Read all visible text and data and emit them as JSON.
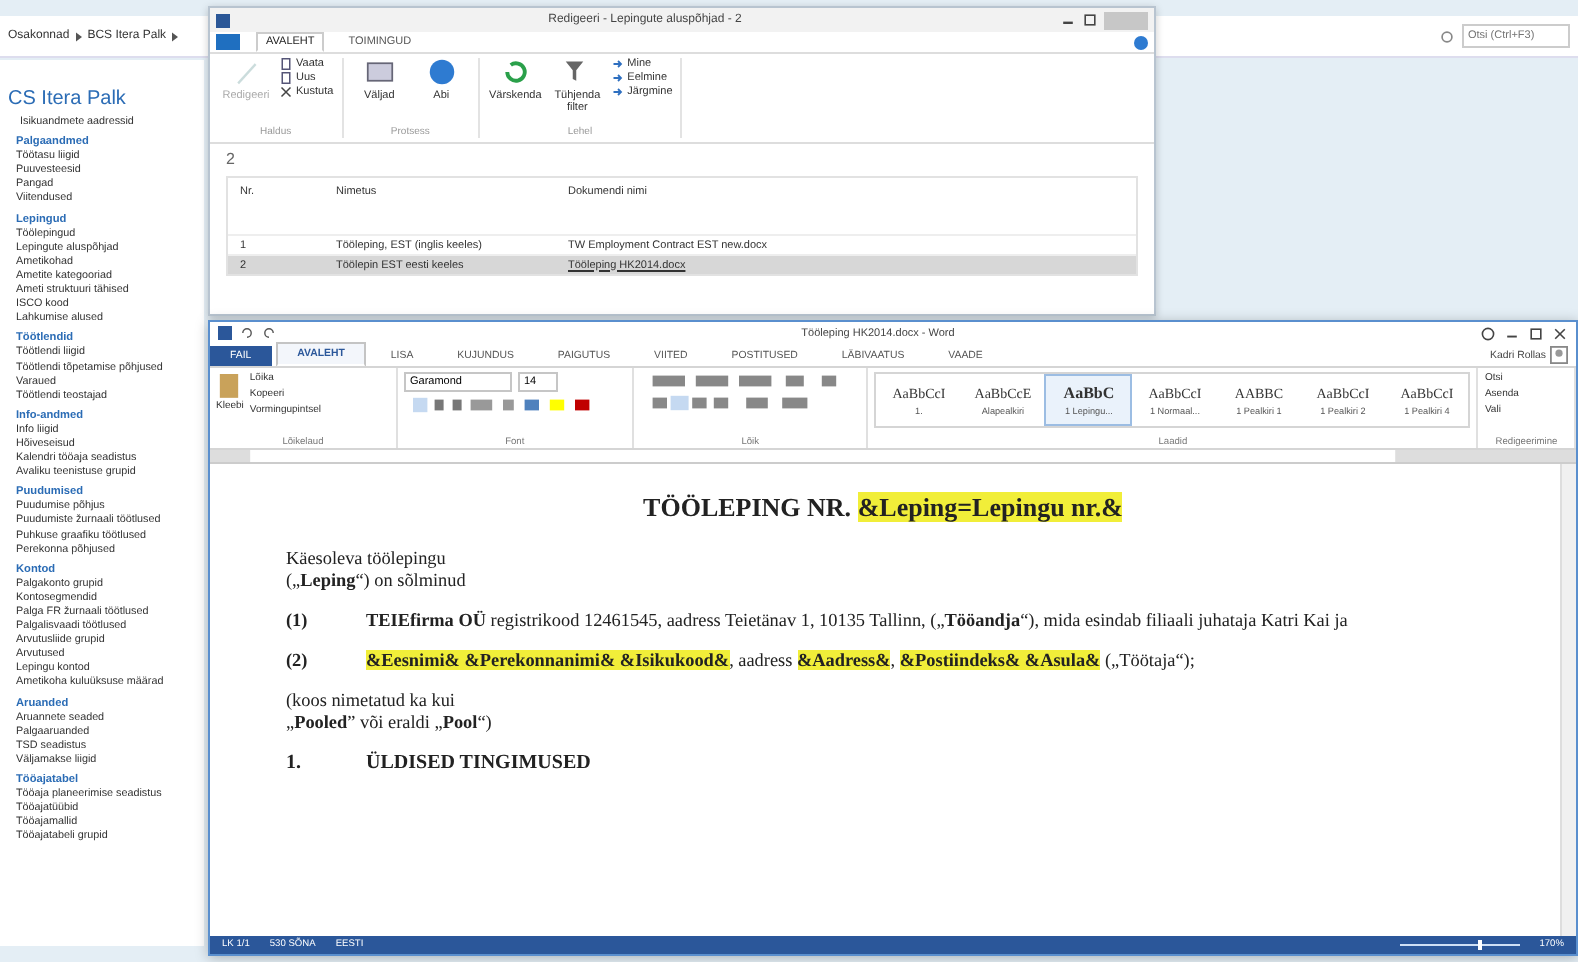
{
  "nav": {
    "breadcrumb": [
      "Osakonnad",
      "BCS Itera Palk"
    ],
    "search": {
      "placeholder": "Otsi (Ctrl+F3)"
    }
  },
  "sidebar": {
    "title": "CS Itera Palk",
    "top_item": "Isikuandmete aadressid",
    "groups": [
      {
        "title": "Palgaandmed",
        "items": [
          "Töötasu liigid",
          "Puuvesteesid",
          "Pangad",
          "Viitendused"
        ]
      },
      {
        "title": "Lepingud",
        "items": [
          "Töölepingud",
          "Lepingute aluspõhjad",
          "Ametikohad",
          "Ametite kategooriad",
          "Ameti struktuuri tähised",
          "ISCO kood",
          "Lahkumise alused"
        ]
      },
      {
        "title": "Töötlendid",
        "items": [
          "Töötlendi liigid",
          "Töötlendi tõpetamise põhjused",
          "Varaued",
          "Töötlendi teostajad"
        ]
      },
      {
        "title": "Info-andmed",
        "items": [
          "Info liigid",
          "Hõiveseisud",
          "Kalendri tööaja seadistus",
          "Avaliku teenistuse grupid"
        ]
      },
      {
        "title": "Puudumised",
        "items": [
          "Puudumise põhjus",
          "Puudumiste žurnaali töötlused",
          "Puhkuse graafiku töötlused",
          "Perekonna põhjused"
        ]
      },
      {
        "title": "Kontod",
        "items": [
          "Palgakonto grupid",
          "Kontosegmendid",
          "Palga FR žurnaali töötlused",
          "Palgalisvaadi töötlused",
          "Arvutusliide grupid",
          "Arvutused",
          "Lepingu kontod",
          "Ametikoha kuluüksuse määrad"
        ]
      },
      {
        "title": "Aruanded",
        "items": [
          "Aruannete seaded",
          "Palgaaruanded",
          "TSD seadistus",
          "Väljamakse liigid"
        ]
      },
      {
        "title": "Tööajatabel",
        "items": [
          "Tööaja planeerimise seadistus",
          "Tööajatüübid",
          "Tööajamallid",
          "Tööajatabeli grupid"
        ]
      }
    ]
  },
  "dialog": {
    "title": "Redigeeri - Lepingute aluspõhjad - 2",
    "tabs": [
      {
        "label": "AVALEHT",
        "selected": true
      },
      {
        "label": "TOIMINGUD",
        "selected": false
      }
    ],
    "ribbon_groups": [
      {
        "label": "Haldus",
        "buttons": [
          {
            "kind": "large",
            "label": "Redigeeri",
            "disabled": true
          },
          {
            "kind": "small",
            "label": "Vaata",
            "disabled": false
          },
          {
            "kind": "small",
            "label": "Uus",
            "disabled": false
          },
          {
            "kind": "small",
            "label": "Kustuta",
            "disabled": false
          }
        ]
      },
      {
        "label": "Protsess",
        "buttons": [
          {
            "kind": "large",
            "label": "Väljad",
            "disabled": false
          },
          {
            "kind": "large",
            "label": "Abi",
            "disabled": false
          }
        ]
      },
      {
        "label": "Lehel",
        "buttons": [
          {
            "kind": "large",
            "label": "Värskenda",
            "disabled": false
          },
          {
            "kind": "large",
            "label": "Tühjenda filter",
            "disabled": false
          },
          {
            "kind": "small",
            "label": "Mine",
            "disabled": false
          },
          {
            "kind": "small",
            "label": "Eelmine",
            "disabled": false
          },
          {
            "kind": "small",
            "label": "Järgmine",
            "disabled": false
          }
        ]
      }
    ],
    "record": "2",
    "table": {
      "columns": [
        "Nr.",
        "Nimetus",
        "Dokumendi nimi"
      ],
      "rows": [
        {
          "cells": [
            "1",
            "Tööleping, EST (inglis keeles)",
            "TW Employment Contract EST new.docx"
          ],
          "selected": false
        },
        {
          "cells": [
            "2",
            "Töölepin EST eesti keeles",
            "Tööleping HK2014.docx"
          ],
          "selected": true
        }
      ]
    }
  },
  "word": {
    "title": "Tööleping HK2014.docx - Word",
    "user": "Kadri Rollas",
    "tabs": [
      {
        "label": "FAIL",
        "kind": "file",
        "selected": false
      },
      {
        "label": "AVALEHT",
        "kind": "tab",
        "selected": true
      },
      {
        "label": "LISA",
        "kind": "tab",
        "selected": false
      },
      {
        "label": "KUJUNDUS",
        "kind": "tab",
        "selected": false
      },
      {
        "label": "PAIGUTUS",
        "kind": "tab",
        "selected": false
      },
      {
        "label": "VIITED",
        "kind": "tab",
        "selected": false
      },
      {
        "label": "POSTITUSED",
        "kind": "tab",
        "selected": false
      },
      {
        "label": "LÄBIVAATUS",
        "kind": "tab",
        "selected": false
      },
      {
        "label": "VAADE",
        "kind": "tab",
        "selected": false
      }
    ],
    "clipboard": {
      "label": "Lõikelaud",
      "paste": "Kleebi",
      "actions": [
        "Lõika",
        "Kopeeri",
        "Vormingupintsel"
      ]
    },
    "font": {
      "label": "Font",
      "family": "Garamond",
      "size": "14"
    },
    "paragraph": {
      "label": "Lõik"
    },
    "styles": {
      "label": "Laadid",
      "items": [
        {
          "sample": "AaBbCcI",
          "name": "1.",
          "selected": false
        },
        {
          "sample": "AaBbCcE",
          "name": "Alapealkiri",
          "selected": false
        },
        {
          "sample": "AaBbC",
          "name": "1 Lepingu...",
          "selected": true
        },
        {
          "sample": "AaBbCcI",
          "name": "1 Normaal...",
          "selected": false
        },
        {
          "sample": "AABBC",
          "name": "1 Pealkiri 1",
          "selected": false
        },
        {
          "sample": "AaBbCcI",
          "name": "1 Pealkiri 2",
          "selected": false
        },
        {
          "sample": "AaBbCcI",
          "name": "1 Pealkiri 4",
          "selected": false
        }
      ]
    },
    "editing": {
      "label": "Redigeerimine",
      "actions": [
        "Otsi",
        "Asenda",
        "Vali"
      ]
    },
    "document": [
      {
        "kind": "title",
        "segments": [
          {
            "text": "TÖÖLEPING NR. ",
            "highlight": false
          },
          {
            "text": "&Leping=Lepingu nr.&",
            "highlight": true
          }
        ]
      },
      {
        "kind": "para",
        "segments": [
          {
            "text": "Käesoleva töölepingu („**Leping**“) on sõlminud",
            "highlight": false
          }
        ]
      },
      {
        "kind": "item",
        "number": "(1)",
        "segments": [
          {
            "text": "**TEIEfirma OÜ** registrikood 12461545, aadress Teietänav 1, 10135 Tallinn, („**Tööandja**“), mida esindab filiaali juhataja Katri Kai ja",
            "highlight": false
          }
        ]
      },
      {
        "kind": "item",
        "number": "(2)",
        "segments": [
          {
            "text": "**&Eesnimi& &Perekonnanimi& &Isikukood&**",
            "highlight": true
          },
          {
            "text": ", aadress ",
            "highlight": false
          },
          {
            "text": "**&Aadress&**",
            "highlight": true
          },
          {
            "text": ", ",
            "highlight": false
          },
          {
            "text": "**&Postiindeks& &Asula&**",
            "highlight": true
          },
          {
            "text": " („Töötaja“);",
            "highlight": false
          }
        ]
      },
      {
        "kind": "para",
        "segments": [
          {
            "text": "(koos nimetatud ka kui „**Pooled**” või eraldi „**Pool**“)",
            "highlight": false
          }
        ]
      },
      {
        "kind": "heading",
        "number": "1.",
        "segments": [
          {
            "text": "ÜLDISED TINGIMUSED",
            "highlight": false
          }
        ]
      }
    ],
    "status": {
      "page": "LK 1/1",
      "words": "530 SÕNA",
      "language": "EESTI",
      "zoom": "170%",
      "level": 0.65
    }
  }
}
